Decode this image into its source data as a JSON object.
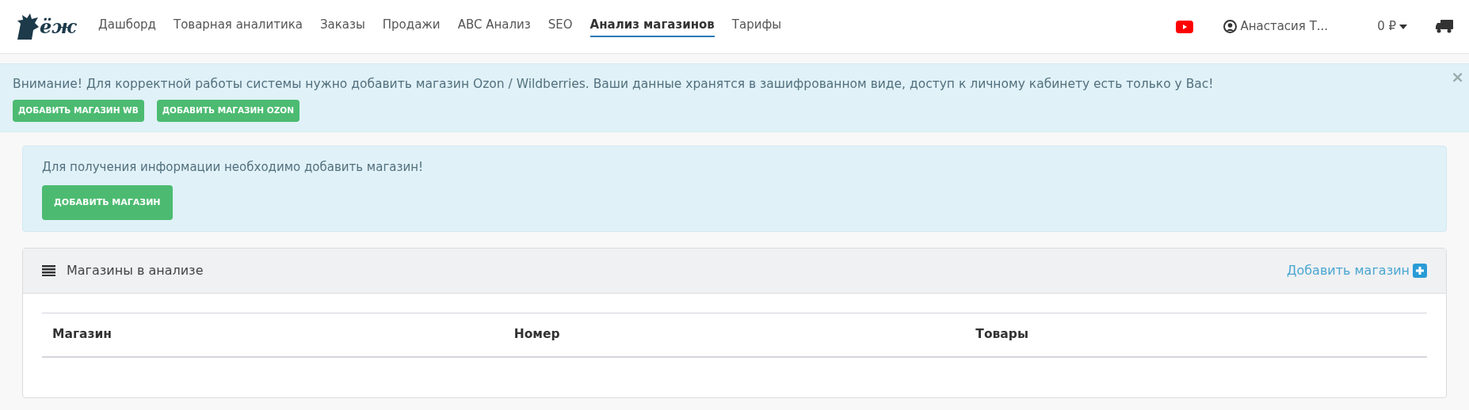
{
  "nav": {
    "logo": "ёж",
    "items": [
      {
        "label": "Дашборд",
        "selected": false
      },
      {
        "label": "Товарная аналитика",
        "selected": false
      },
      {
        "label": "Заказы",
        "selected": false
      },
      {
        "label": "Продажи",
        "selected": false
      },
      {
        "label": "ABC Анализ",
        "selected": false
      },
      {
        "label": "SEO",
        "selected": false
      },
      {
        "label": "Анализ магазинов",
        "selected": true
      },
      {
        "label": "Тарифы",
        "selected": false
      }
    ],
    "user": "Анастасия Т...",
    "balance": "0 ₽"
  },
  "alert": {
    "text": "Внимание! Для корректной работы системы нужно добавить магазин Ozon / Wildberries. Ваши данные хранятся в зашифрованном виде, доступ к личному кабинету есть только у Вас!",
    "close": "×",
    "buttons": [
      "ДОБАВИТЬ МАГАЗИН WB",
      "ДОБАВИТЬ МАГАЗИН OZON"
    ]
  },
  "info": {
    "text": "Для получения информации необходимо добавить магазин!",
    "button": "ДОБАВИТЬ МАГАЗИН"
  },
  "card": {
    "title": "Магазины в анализе",
    "add_link": "Добавить магазин",
    "table": {
      "columns": [
        "Магазин",
        "Номер",
        "Товары"
      ]
    }
  }
}
